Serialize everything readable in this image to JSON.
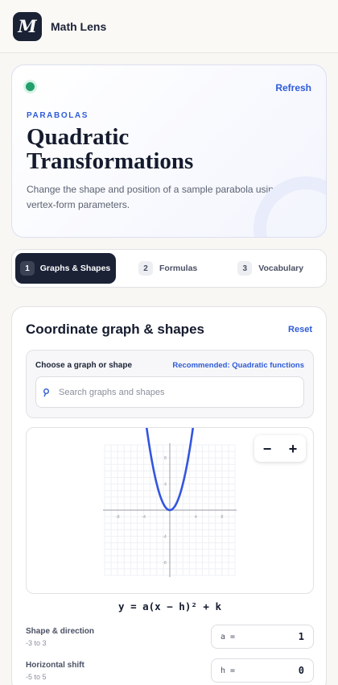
{
  "app": {
    "logo_letter": "M",
    "name": "Math Lens"
  },
  "hero": {
    "refresh_label": "Refresh",
    "kicker": "PARABOLAS",
    "title": "Quadratic Transformations",
    "subtitle": "Change the shape and position of a sample parabola using vertex-form parameters.",
    "status_color": "#22a06b"
  },
  "steps": [
    {
      "number": "1",
      "label": "Graphs & Shapes",
      "active": true
    },
    {
      "number": "2",
      "label": "Formulas",
      "active": false
    },
    {
      "number": "3",
      "label": "Vocabulary",
      "active": false
    }
  ],
  "card": {
    "title": "Coordinate graph & shapes",
    "reset_label": "Reset",
    "chooser": {
      "label": "Choose a graph or shape",
      "recommended": "Recommended: Quadratic functions",
      "search_placeholder": "Search graphs and shapes"
    },
    "zoom": {
      "minus": "−",
      "plus": "+"
    },
    "equation": "y = a(x − h)² + k",
    "params": [
      {
        "label": "Shape & direction",
        "range": "-3 to 3",
        "var": "a =",
        "value": "1"
      },
      {
        "label": "Horizontal shift",
        "range": "-5 to 5",
        "var": "h =",
        "value": "0"
      }
    ]
  },
  "chart_data": {
    "type": "line",
    "function": "y = a(x - h)^2 + k",
    "a": 1,
    "h": 0,
    "k": 0,
    "x_ticks": [
      -8,
      -4,
      4,
      8
    ],
    "y_ticks": [
      8,
      4,
      -4,
      -8
    ],
    "xlim": [
      -10,
      10
    ],
    "ylim": [
      -10,
      10
    ],
    "grid": true,
    "line_color": "#3355e0"
  },
  "colors": {
    "accent": "#2e5bd8",
    "dark": "#1b2236"
  }
}
